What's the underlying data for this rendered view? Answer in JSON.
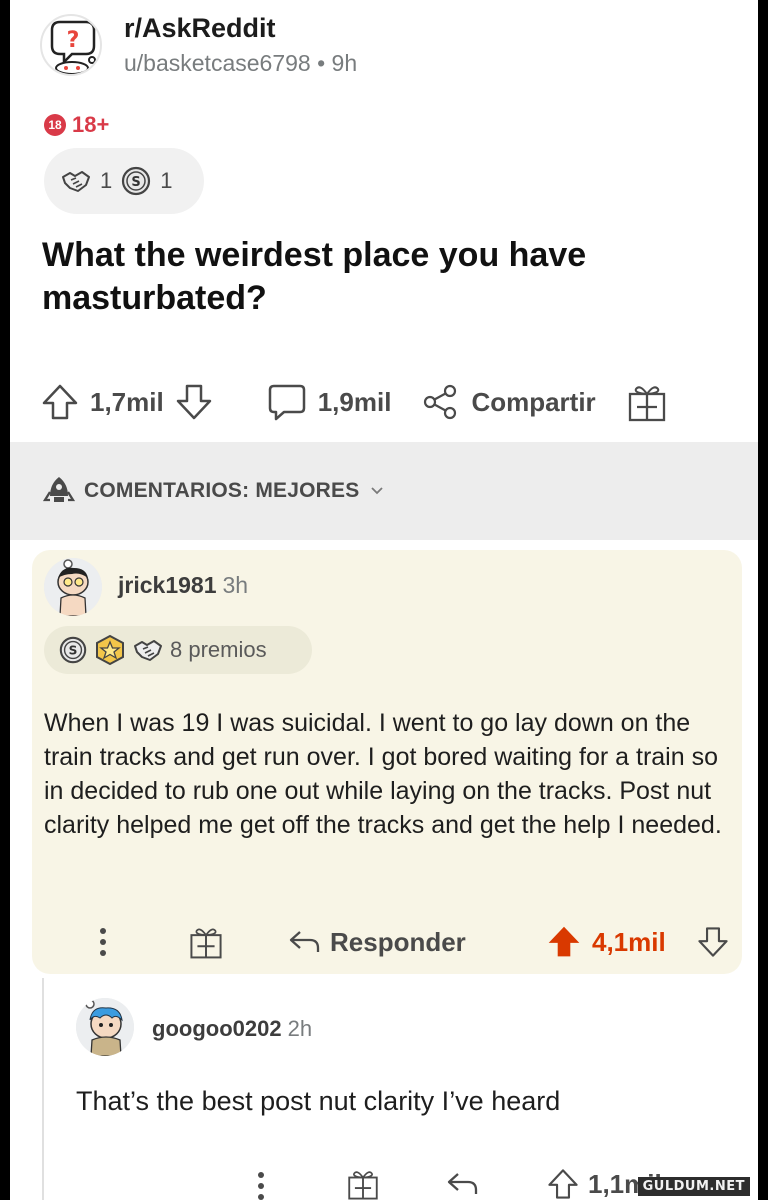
{
  "post": {
    "subreddit": "r/AskReddit",
    "user": "u/basketcase6798",
    "separator": " • ",
    "age": "9h",
    "nsfw_badge": "18",
    "nsfw_label": "18+",
    "awards": [
      {
        "icon": "handshake-icon",
        "count": "1"
      },
      {
        "icon": "silver-coin-icon",
        "count": "1"
      }
    ],
    "title": "What the weirdest place you have masturbated?",
    "upvotes": "1,7mil",
    "comments": "1,9mil",
    "share_label": "Compartir"
  },
  "sort": {
    "label": "COMENTARIOS: MEJORES"
  },
  "comment": {
    "username": "jrick1981",
    "age": "3h",
    "awards_label": "8 premios",
    "body": "When I was 19 I was suicidal. I went to go lay down on the train tracks and get run over. I got bored waiting for a train so in decided to rub one out while laying on the tracks. Post nut clarity helped me get off the tracks and get the help I needed.",
    "reply_label": "Responder",
    "score": "4,1mil",
    "accent": "#d93900"
  },
  "reply": {
    "username": "googoo0202",
    "age": "2h",
    "body": "That’s the best post nut clarity I’ve heard",
    "score": "1,1mil"
  },
  "watermark": "GULDUM.NET"
}
